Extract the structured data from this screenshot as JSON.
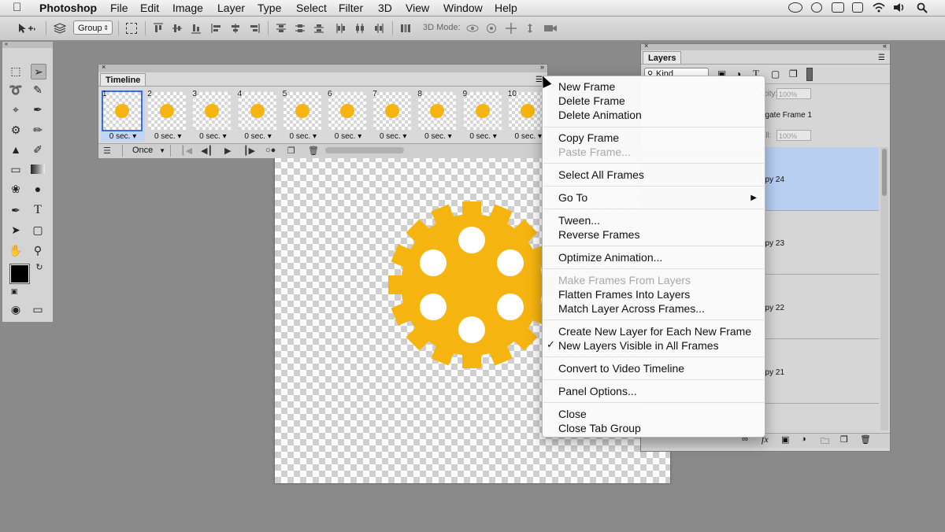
{
  "menubar": {
    "app": "Photoshop",
    "items": [
      "File",
      "Edit",
      "Image",
      "Layer",
      "Type",
      "Select",
      "Filter",
      "3D",
      "View",
      "Window",
      "Help"
    ]
  },
  "options_bar": {
    "group_select": "Group",
    "mode_3d_label": "3D Mode:"
  },
  "timeline": {
    "tab": "Timeline",
    "frames": [
      {
        "num": "1",
        "delay": "0 sec."
      },
      {
        "num": "2",
        "delay": "0 sec."
      },
      {
        "num": "3",
        "delay": "0 sec."
      },
      {
        "num": "4",
        "delay": "0 sec."
      },
      {
        "num": "5",
        "delay": "0 sec."
      },
      {
        "num": "6",
        "delay": "0 sec."
      },
      {
        "num": "7",
        "delay": "0 sec."
      },
      {
        "num": "8",
        "delay": "0 sec."
      },
      {
        "num": "9",
        "delay": "0 sec."
      },
      {
        "num": "10",
        "delay": "0 sec."
      }
    ],
    "selected_frame": 1,
    "loop": "Once"
  },
  "layers": {
    "tab": "Layers",
    "filter": "Kind",
    "opacity_label": "acity:",
    "opacity": "100%",
    "fill_label": "ill:",
    "fill": "100%",
    "propagate": "agate Frame 1",
    "rows": [
      {
        "name": "opy 24",
        "selected": true
      },
      {
        "name": "opy 23",
        "selected": false
      },
      {
        "name": "opy 22",
        "selected": false
      },
      {
        "name": "opy 21",
        "selected": false
      }
    ]
  },
  "context_menu": {
    "items": {
      "new_frame": "New Frame",
      "delete_frame": "Delete Frame",
      "delete_animation": "Delete Animation",
      "copy_frame": "Copy Frame",
      "paste_frame": "Paste Frame...",
      "select_all_frames": "Select All Frames",
      "go_to": "Go To",
      "tween": "Tween...",
      "reverse_frames": "Reverse Frames",
      "optimize_animation": "Optimize Animation...",
      "make_frames_from_layers": "Make Frames From Layers",
      "flatten_frames": "Flatten Frames Into Layers",
      "match_layer": "Match Layer Across Frames...",
      "create_new_layer": "Create New Layer for Each New Frame",
      "new_layers_visible": "New Layers Visible in All Frames",
      "convert_video": "Convert to Video Timeline",
      "panel_options": "Panel Options...",
      "close": "Close",
      "close_tab_group": "Close Tab Group"
    },
    "checkmark": "✓"
  },
  "colors": {
    "gear": "#f5b40f",
    "selection": "#b8cff2"
  }
}
